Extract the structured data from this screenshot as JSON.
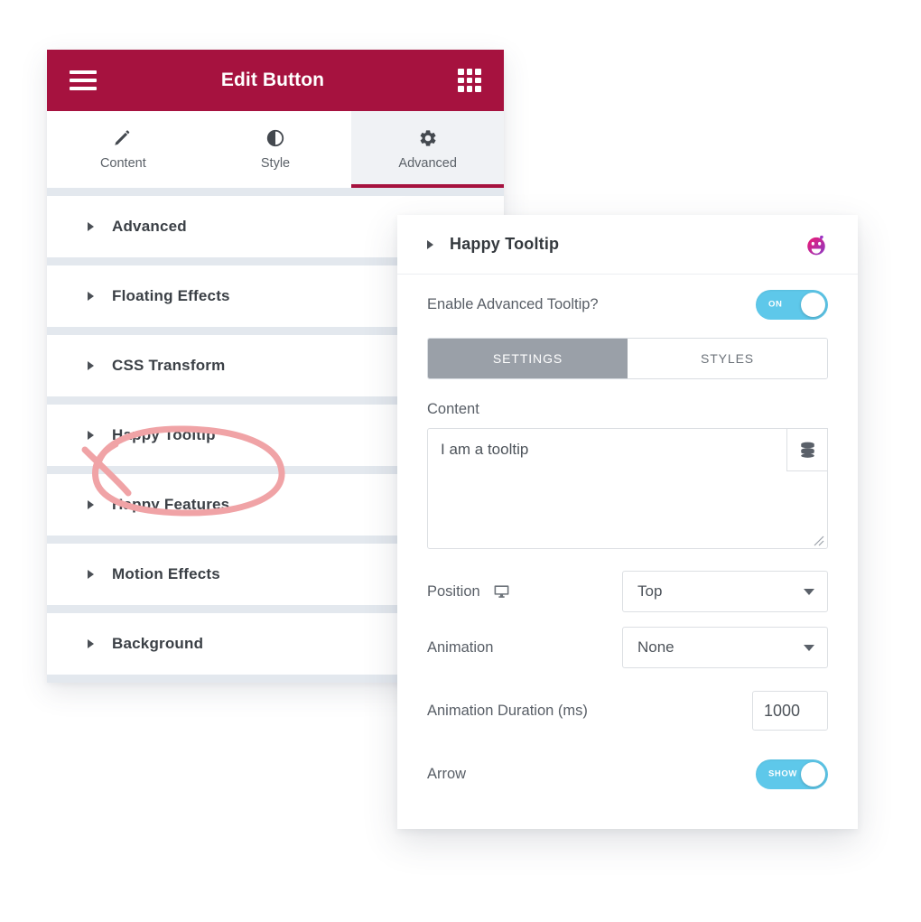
{
  "editor": {
    "header": {
      "title": "Edit Button",
      "menu_icon": "hamburger-icon",
      "apps_icon": "grid-icon"
    },
    "tabs": [
      {
        "label": "Content",
        "icon": "pencil-icon",
        "active": false
      },
      {
        "label": "Style",
        "icon": "contrast-circle-icon",
        "active": false
      },
      {
        "label": "Advanced",
        "icon": "gear-icon",
        "active": true
      }
    ],
    "sections": [
      {
        "label": "Advanced"
      },
      {
        "label": "Floating Effects"
      },
      {
        "label": "CSS Transform"
      },
      {
        "label": "Happy Tooltip"
      },
      {
        "label": "Happy Features"
      },
      {
        "label": "Motion Effects"
      },
      {
        "label": "Background"
      }
    ]
  },
  "popup": {
    "title": "Happy Tooltip",
    "brand_icon": "happy-addons-smiley-icon",
    "enable_row": {
      "label": "Enable Advanced Tooltip?",
      "toggle_state": "ON"
    },
    "segmented_tabs": [
      {
        "label": "SETTINGS",
        "active": true
      },
      {
        "label": "STYLES",
        "active": false
      }
    ],
    "content": {
      "label": "Content",
      "value": "I am a tooltip",
      "placeholder": "",
      "dynamic_tags_icon": "database-stack-icon"
    },
    "position": {
      "label": "Position",
      "device_icon": "monitor-icon",
      "value": "Top"
    },
    "animation": {
      "label": "Animation",
      "value": "None"
    },
    "animation_duration": {
      "label": "Animation Duration (ms)",
      "value": "1000"
    },
    "arrow": {
      "label": "Arrow",
      "toggle_state": "SHOW"
    }
  },
  "annotation": {
    "shape": "hand-drawn-ellipse",
    "target": "Happy Tooltip",
    "color": "#F0A3A6"
  },
  "colors": {
    "header_crimson": "#A6123F",
    "toggle_blue": "#5EC8EA",
    "divider_gray": "#E3E8EE",
    "active_tab_bg": "#F0F2F5",
    "segment_active": "#9AA0A8"
  }
}
